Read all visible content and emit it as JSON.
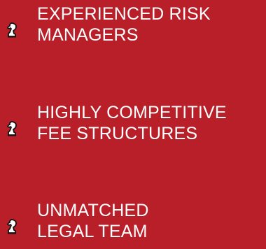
{
  "features": [
    {
      "icon": "chess-knight-icon",
      "line1": "EXPERIENCED RISK",
      "line2": "MANAGERS"
    },
    {
      "icon": "chess-knight-icon",
      "line1": "HIGHLY COMPETITIVE",
      "line2": "FEE STRUCTURES"
    },
    {
      "icon": "chess-knight-icon",
      "line1": "UNMATCHED",
      "line2": "LEGAL TEAM"
    }
  ],
  "colors": {
    "background": "#b91f28",
    "text": "#ffffff",
    "icon_fill": "#ffffff",
    "icon_outline": "#111111"
  }
}
